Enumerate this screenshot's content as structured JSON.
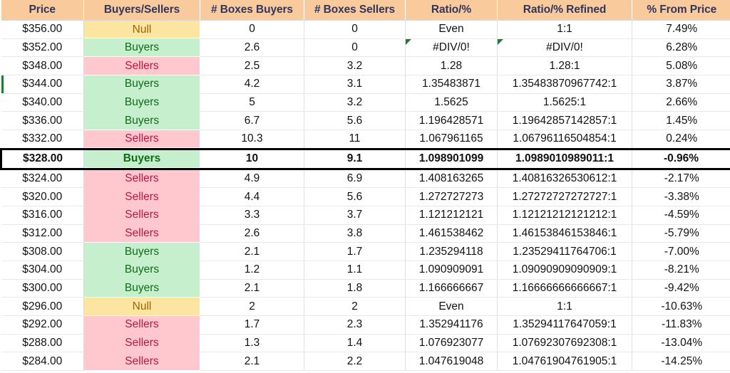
{
  "table": {
    "columns": [
      {
        "key": "price",
        "label": "Price"
      },
      {
        "key": "signal",
        "label": "Buyers/Sellers"
      },
      {
        "key": "boxes_buyers",
        "label": "# Boxes Buyers"
      },
      {
        "key": "boxes_sellers",
        "label": "# Boxes Sellers"
      },
      {
        "key": "ratio",
        "label": "Ratio/%"
      },
      {
        "key": "ratio_refined",
        "label": "Ratio/% Refined"
      },
      {
        "key": "pct_from",
        "label": "% From Price"
      }
    ],
    "header_fill": "#F9CB9C",
    "header_text_color": "#31365F",
    "fill_colors": {
      "buyers": "#C6EFCE",
      "sellers": "#FFC7CE",
      "null": "#FCE5A0"
    },
    "text_colors": {
      "buyers": "#106B18",
      "sellers": "#C0143C",
      "null": "#9C6500"
    },
    "rows": [
      {
        "price": "$356.00",
        "signal": "Null",
        "signal_kind": "null",
        "boxes_buyers": "0",
        "boxes_sellers": "0",
        "ratio": "Even",
        "ratio_refined": "1:1",
        "pct_from": "7.49%",
        "highlight": false,
        "error_marker_ratio": false,
        "error_marker_refined": false,
        "left_marker": false
      },
      {
        "price": "$352.00",
        "signal": "Buyers",
        "signal_kind": "buyers",
        "boxes_buyers": "2.6",
        "boxes_sellers": "0",
        "ratio": "#DIV/0!",
        "ratio_refined": "#DIV/0!",
        "pct_from": "6.28%",
        "highlight": false,
        "error_marker_ratio": true,
        "error_marker_refined": true,
        "left_marker": false
      },
      {
        "price": "$348.00",
        "signal": "Sellers",
        "signal_kind": "sellers",
        "boxes_buyers": "2.5",
        "boxes_sellers": "3.2",
        "ratio": "1.28",
        "ratio_refined": "1.28:1",
        "pct_from": "5.08%",
        "highlight": false,
        "error_marker_ratio": false,
        "error_marker_refined": false,
        "left_marker": false
      },
      {
        "price": "$344.00",
        "signal": "Buyers",
        "signal_kind": "buyers",
        "boxes_buyers": "4.2",
        "boxes_sellers": "3.1",
        "ratio": "1.35483871",
        "ratio_refined": "1.35483870967742:1",
        "pct_from": "3.87%",
        "highlight": false,
        "error_marker_ratio": false,
        "error_marker_refined": false,
        "left_marker": true
      },
      {
        "price": "$340.00",
        "signal": "Buyers",
        "signal_kind": "buyers",
        "boxes_buyers": "5",
        "boxes_sellers": "3.2",
        "ratio": "1.5625",
        "ratio_refined": "1.5625:1",
        "pct_from": "2.66%",
        "highlight": false,
        "error_marker_ratio": false,
        "error_marker_refined": false,
        "left_marker": false
      },
      {
        "price": "$336.00",
        "signal": "Buyers",
        "signal_kind": "buyers",
        "boxes_buyers": "6.7",
        "boxes_sellers": "5.6",
        "ratio": "1.196428571",
        "ratio_refined": "1.19642857142857:1",
        "pct_from": "1.45%",
        "highlight": false,
        "error_marker_ratio": false,
        "error_marker_refined": false,
        "left_marker": false
      },
      {
        "price": "$332.00",
        "signal": "Sellers",
        "signal_kind": "sellers",
        "boxes_buyers": "10.3",
        "boxes_sellers": "11",
        "ratio": "1.067961165",
        "ratio_refined": "1.06796116504854:1",
        "pct_from": "0.24%",
        "highlight": false,
        "error_marker_ratio": false,
        "error_marker_refined": false,
        "left_marker": false
      },
      {
        "price": "$328.00",
        "signal": "Buyers",
        "signal_kind": "buyers",
        "boxes_buyers": "10",
        "boxes_sellers": "9.1",
        "ratio": "1.098901099",
        "ratio_refined": "1.0989010989011:1",
        "pct_from": "-0.96%",
        "highlight": true,
        "error_marker_ratio": false,
        "error_marker_refined": false,
        "left_marker": false
      },
      {
        "price": "$324.00",
        "signal": "Sellers",
        "signal_kind": "sellers",
        "boxes_buyers": "4.9",
        "boxes_sellers": "6.9",
        "ratio": "1.408163265",
        "ratio_refined": "1.40816326530612:1",
        "pct_from": "-2.17%",
        "highlight": false,
        "error_marker_ratio": false,
        "error_marker_refined": false,
        "left_marker": false
      },
      {
        "price": "$320.00",
        "signal": "Sellers",
        "signal_kind": "sellers",
        "boxes_buyers": "4.4",
        "boxes_sellers": "5.6",
        "ratio": "1.272727273",
        "ratio_refined": "1.27272727272727:1",
        "pct_from": "-3.38%",
        "highlight": false,
        "error_marker_ratio": false,
        "error_marker_refined": false,
        "left_marker": false
      },
      {
        "price": "$316.00",
        "signal": "Sellers",
        "signal_kind": "sellers",
        "boxes_buyers": "3.3",
        "boxes_sellers": "3.7",
        "ratio": "1.121212121",
        "ratio_refined": "1.12121212121212:1",
        "pct_from": "-4.59%",
        "highlight": false,
        "error_marker_ratio": false,
        "error_marker_refined": false,
        "left_marker": false
      },
      {
        "price": "$312.00",
        "signal": "Sellers",
        "signal_kind": "sellers",
        "boxes_buyers": "2.6",
        "boxes_sellers": "3.8",
        "ratio": "1.461538462",
        "ratio_refined": "1.46153846153846:1",
        "pct_from": "-5.79%",
        "highlight": false,
        "error_marker_ratio": false,
        "error_marker_refined": false,
        "left_marker": false
      },
      {
        "price": "$308.00",
        "signal": "Buyers",
        "signal_kind": "buyers",
        "boxes_buyers": "2.1",
        "boxes_sellers": "1.7",
        "ratio": "1.235294118",
        "ratio_refined": "1.23529411764706:1",
        "pct_from": "-7.00%",
        "highlight": false,
        "error_marker_ratio": false,
        "error_marker_refined": false,
        "left_marker": false
      },
      {
        "price": "$304.00",
        "signal": "Buyers",
        "signal_kind": "buyers",
        "boxes_buyers": "1.2",
        "boxes_sellers": "1.1",
        "ratio": "1.090909091",
        "ratio_refined": "1.09090909090909:1",
        "pct_from": "-8.21%",
        "highlight": false,
        "error_marker_ratio": false,
        "error_marker_refined": false,
        "left_marker": false
      },
      {
        "price": "$300.00",
        "signal": "Buyers",
        "signal_kind": "buyers",
        "boxes_buyers": "2.1",
        "boxes_sellers": "1.8",
        "ratio": "1.166666667",
        "ratio_refined": "1.16666666666667:1",
        "pct_from": "-9.42%",
        "highlight": false,
        "error_marker_ratio": false,
        "error_marker_refined": false,
        "left_marker": false
      },
      {
        "price": "$296.00",
        "signal": "Null",
        "signal_kind": "null",
        "boxes_buyers": "2",
        "boxes_sellers": "2",
        "ratio": "Even",
        "ratio_refined": "1:1",
        "pct_from": "-10.63%",
        "highlight": false,
        "error_marker_ratio": false,
        "error_marker_refined": false,
        "left_marker": false
      },
      {
        "price": "$292.00",
        "signal": "Sellers",
        "signal_kind": "sellers",
        "boxes_buyers": "1.7",
        "boxes_sellers": "2.3",
        "ratio": "1.352941176",
        "ratio_refined": "1.35294117647059:1",
        "pct_from": "-11.83%",
        "highlight": false,
        "error_marker_ratio": false,
        "error_marker_refined": false,
        "left_marker": false
      },
      {
        "price": "$288.00",
        "signal": "Sellers",
        "signal_kind": "sellers",
        "boxes_buyers": "1.3",
        "boxes_sellers": "1.4",
        "ratio": "1.076923077",
        "ratio_refined": "1.07692307692308:1",
        "pct_from": "-13.04%",
        "highlight": false,
        "error_marker_ratio": false,
        "error_marker_refined": false,
        "left_marker": false
      },
      {
        "price": "$284.00",
        "signal": "Sellers",
        "signal_kind": "sellers",
        "boxes_buyers": "2.1",
        "boxes_sellers": "2.2",
        "ratio": "1.047619048",
        "ratio_refined": "1.04761904761905:1",
        "pct_from": "-14.25%",
        "highlight": false,
        "error_marker_ratio": false,
        "error_marker_refined": false,
        "left_marker": false
      }
    ]
  }
}
